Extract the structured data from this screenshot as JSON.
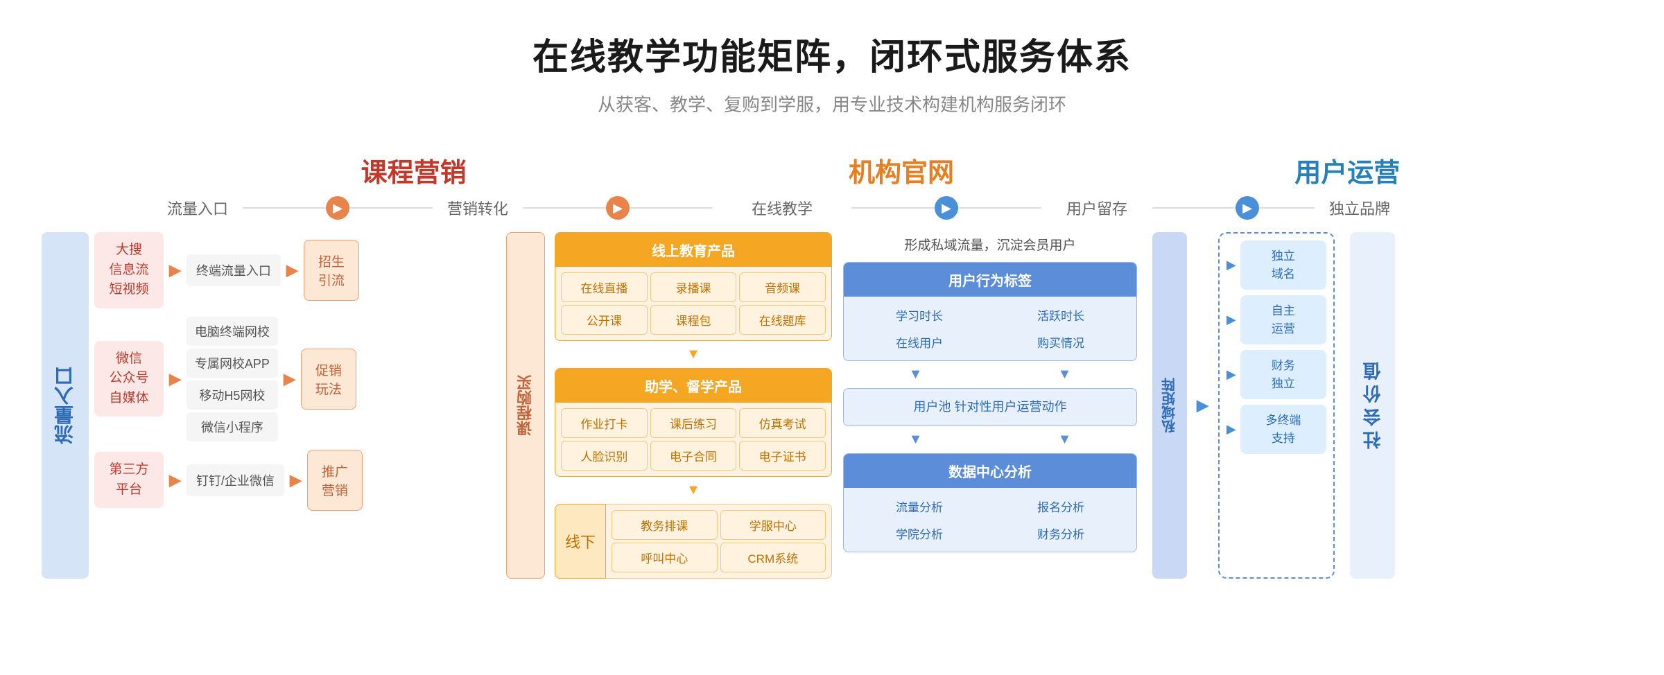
{
  "page": {
    "title": "在线教学功能矩阵，闭环式服务体系",
    "subtitle": "从获客、教学、复购到学服，用专业技术构建机构服务闭环"
  },
  "col_headers": {
    "marketing": "课程营销",
    "official": "机构官网",
    "operations": "用户运营"
  },
  "flow_stages": {
    "traffic": "流量入口",
    "conversion": "营销转化",
    "online_teaching": "在线教学",
    "user_retention": "用户留存",
    "brand": "独立品牌"
  },
  "left_label": "流\n量\n入\n口",
  "traffic_sources": [
    {
      "name": "大搜\n信息流\n短视频",
      "endpoints": [
        "终端流量入口"
      ],
      "conversion": "招生\n引流"
    },
    {
      "name": "微信\n公众号\n自媒体",
      "endpoints": [
        "电脑终端网校",
        "专属网校APP",
        "移动H5网校",
        "微信小程序"
      ],
      "conversion": "促销\n玩法"
    },
    {
      "name": "第三方\n平台",
      "endpoints": [
        "钉钉/企业微信"
      ],
      "conversion": "推广\n营销"
    }
  ],
  "course_buy_label": "课\n程\n购\n买",
  "online_teaching": {
    "product_header": "线上教育产品",
    "products": [
      "在线直播",
      "录播课",
      "音频课",
      "公开课",
      "课程包",
      "在线题库"
    ],
    "assist_header": "助学、督学产品",
    "assists": [
      "作业打卡",
      "课后练习",
      "仿真考试",
      "人脸识别",
      "电子合同",
      "电子证书"
    ],
    "offline_label": "线下",
    "offline_items": [
      "教务排课",
      "学服中心",
      "呼叫中心",
      "CRM系统"
    ]
  },
  "user_retention": {
    "private_flow_text": "形成私域流量，沉淀会员用户",
    "behavior_tag_header": "用户行为标签",
    "behavior_tags": [
      "学习时长",
      "活跃时长",
      "在线用户",
      "购买情况"
    ],
    "user_pool_text": "用户池\n针对性用户运营动作",
    "data_center_header": "数据中心分析",
    "data_items": [
      "流量分析",
      "报名分析",
      "学院分析",
      "财务分析"
    ]
  },
  "private_domain_label": "私\n域\n矩\n阵",
  "brand_items": [
    "独立\n域名",
    "自主\n运营",
    "财务\n独立",
    "多终端\n支持"
  ],
  "social_value_label": "社\n会\n价\n值"
}
